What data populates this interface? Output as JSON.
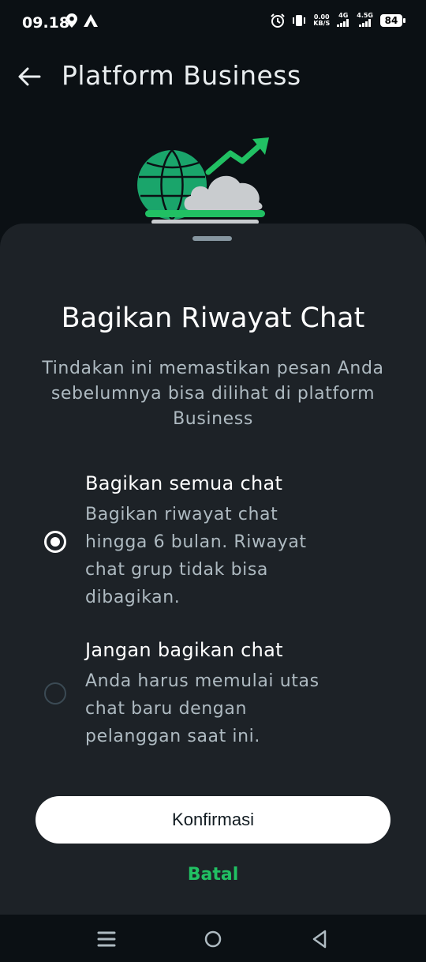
{
  "status_bar": {
    "time": "09.18",
    "data_speed_value": "0.00",
    "data_speed_unit": "KB/S",
    "network_1": "4G",
    "network_2": "4.5G",
    "battery": "84"
  },
  "app_bar": {
    "title": "Platform Business"
  },
  "sheet": {
    "title": "Bagikan Riwayat Chat",
    "description": "Tindakan ini memastikan pesan Anda sebelumnya bisa dilihat di platform Business",
    "options": [
      {
        "title": "Bagikan semua chat",
        "subtitle": "Bagikan riwayat chat hingga 6 bulan. Riwayat chat grup tidak bisa dibagikan.",
        "selected": true
      },
      {
        "title": "Jangan bagikan chat",
        "subtitle": "Anda harus memulai utas chat baru dengan pelanggan saat ini.",
        "selected": false
      }
    ],
    "confirm_label": "Konfirmasi",
    "cancel_label": "Batal"
  },
  "colors": {
    "background": "#0b1014",
    "sheet": "#1d2227",
    "accent": "#21c063"
  }
}
